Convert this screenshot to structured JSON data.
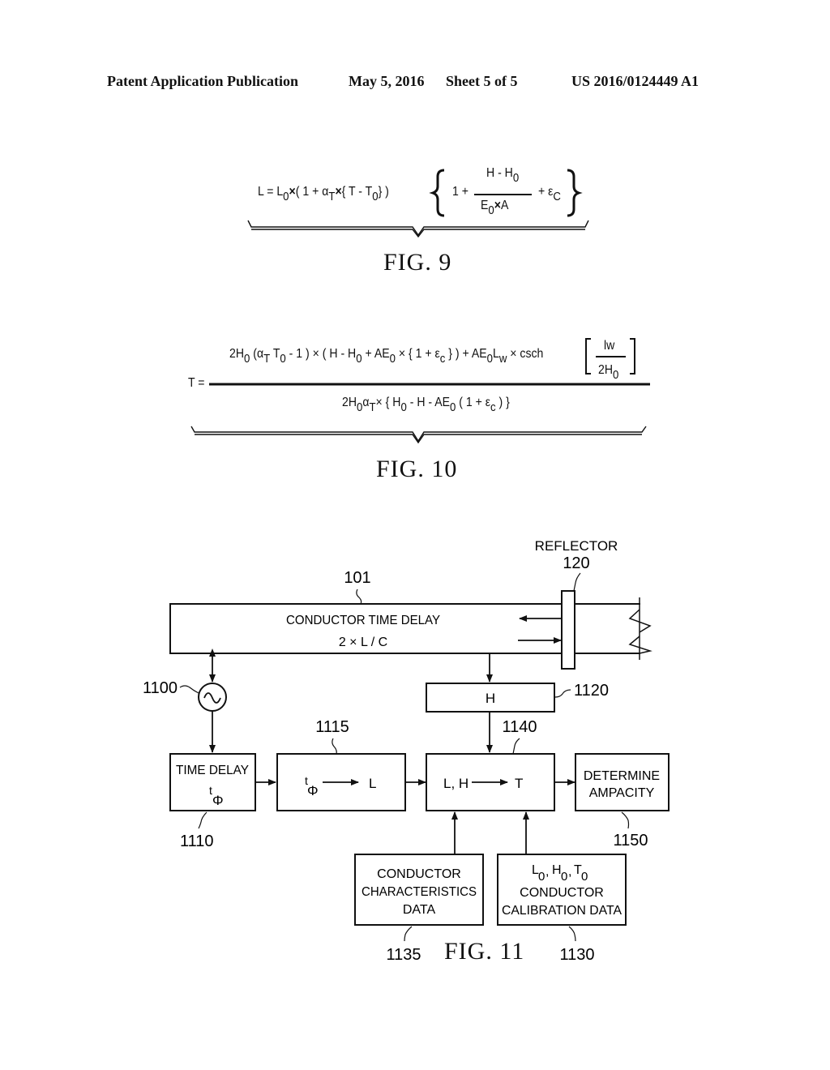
{
  "header": {
    "publication_type": "Patent Application Publication",
    "date": "May 5, 2016",
    "sheet": "Sheet 5 of 5",
    "publication_number": "US 2016/0124449 A1"
  },
  "fig9": {
    "label": "FIG. 9",
    "equation_text": "L = L0 × (1 + αT × {T - T0}) {1 + (H - H0)/(E0 × A) + εC}",
    "lhs": "L = L",
    "sub0": "0",
    "times": "×",
    "open": "( 1 + α",
    "subT": "T",
    "mid": "{ T - T",
    "close": "} )",
    "brace_open": "{",
    "one_plus": "1 +",
    "num_a": "H - H",
    "den_a": "E",
    "den_b": "A",
    "plus_eps": "+ ε",
    "subC": "C",
    "brace_close": "}"
  },
  "fig10": {
    "label": "FIG. 10",
    "equation_text": "T = [2H0(αT T0 - 1) × (H - H0 + AE0 × {1 + εc}) + AE0Lw × csch[lw / 2H0]] / [2H0αT × {H0 - H - AE0(1 + εc)}]",
    "lhs": "T =",
    "n1": "2H",
    "n2": " (α",
    "n3": " T",
    "n4": " - 1 ) × ( H - H",
    "n5": " + AE",
    "n6": " × { 1 + ε",
    "n7": " } ) + AE",
    "n8": "L",
    "n9": " × csch",
    "sub0": "0",
    "subT": "T",
    "subc": "c",
    "subw": "w",
    "frac_num": "lw",
    "frac_den": "2H",
    "d1": "2H",
    "d2": "α",
    "d3": "× { H",
    "d4": " - H - AE",
    "d5": " ( 1 + ε",
    "d6": " ) }"
  },
  "fig11": {
    "label": "FIG. 11",
    "conductor": {
      "ref": "101",
      "line1": "CONDUCTOR TIME DELAY",
      "line2": "2 × L / C"
    },
    "reflector": {
      "label": "REFLECTOR",
      "ref": "120"
    },
    "source": {
      "ref": "1100",
      "symbol": "~"
    },
    "time_delay": {
      "ref": "1110",
      "line1": "TIME DELAY",
      "symbol_t": "t",
      "symbol_phi": "Φ"
    },
    "convert_L": {
      "ref": "1115",
      "from_t": "t",
      "from_phi": "Φ",
      "to": "L"
    },
    "height": {
      "ref": "1120",
      "label": "H"
    },
    "compute_T": {
      "ref": "1140",
      "from": "L, H",
      "to": "T"
    },
    "ampacity": {
      "ref": "1150",
      "line1": "DETERMINE",
      "line2": "AMPACITY"
    },
    "characteristics": {
      "ref": "1135",
      "line1": "CONDUCTOR",
      "line2": "CHARACTERISTICS",
      "line3": "DATA"
    },
    "calibration": {
      "ref": "1130",
      "l": "L",
      "h": "H",
      "t": "T",
      "sub0": "0",
      "comma": ",",
      "line2": "CONDUCTOR",
      "line3": "CALIBRATION DATA"
    }
  }
}
